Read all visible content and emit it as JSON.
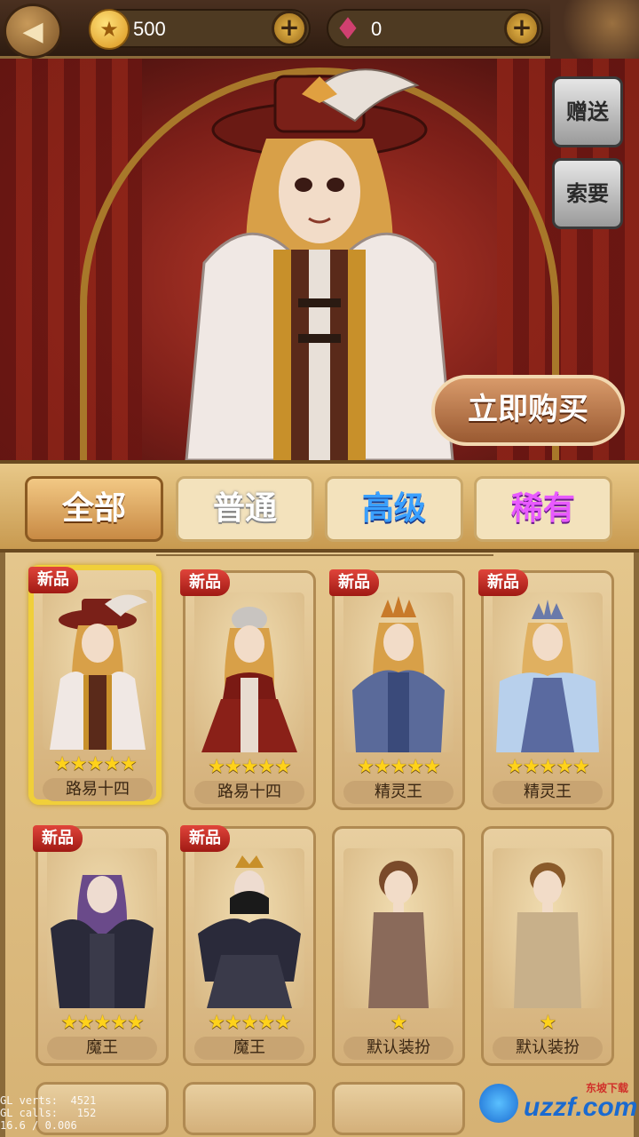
{
  "topbar": {
    "back_icon": "back-arrow-icon",
    "coins": "500",
    "gems": "0",
    "plus": "+"
  },
  "hero": {
    "gift_label": "赠送",
    "ask_label": "索要",
    "buy_label": "立即购买"
  },
  "tabs": [
    {
      "label": "全部",
      "color": "#ffffff",
      "active": true
    },
    {
      "label": "普通",
      "color": "#ffffff",
      "active": false
    },
    {
      "label": "高级",
      "color": "#3aa0ff",
      "active": false
    },
    {
      "label": "稀有",
      "color": "#e85aff",
      "active": false
    }
  ],
  "items": [
    {
      "name": "路易十四",
      "stars": 5,
      "badge": "新品",
      "selected": true,
      "outfit": "musketeer"
    },
    {
      "name": "路易十四",
      "stars": 5,
      "badge": "新品",
      "selected": false,
      "outfit": "red-dress"
    },
    {
      "name": "精灵王",
      "stars": 5,
      "badge": "新品",
      "selected": false,
      "outfit": "elf-king"
    },
    {
      "name": "精灵王",
      "stars": 5,
      "badge": "新品",
      "selected": false,
      "outfit": "elf-queen"
    },
    {
      "name": "魔王",
      "stars": 5,
      "badge": "新品",
      "selected": false,
      "outfit": "demon-king"
    },
    {
      "name": "魔王",
      "stars": 5,
      "badge": "新品",
      "selected": false,
      "outfit": "demon-queen"
    },
    {
      "name": "默认装扮",
      "stars": 1,
      "badge": "",
      "selected": false,
      "outfit": "default-female"
    },
    {
      "name": "默认装扮",
      "stars": 1,
      "badge": "",
      "selected": false,
      "outfit": "default-male"
    }
  ],
  "debug": "GL verts:  4521\nGL calls:   152\n16.6 / 0.006",
  "watermark": {
    "text": "uzzf.com",
    "small": "东坡下载"
  },
  "colors": {
    "star": "#ffd21a",
    "badge": "#c8281e",
    "selected_border": "#f0cf3a"
  }
}
